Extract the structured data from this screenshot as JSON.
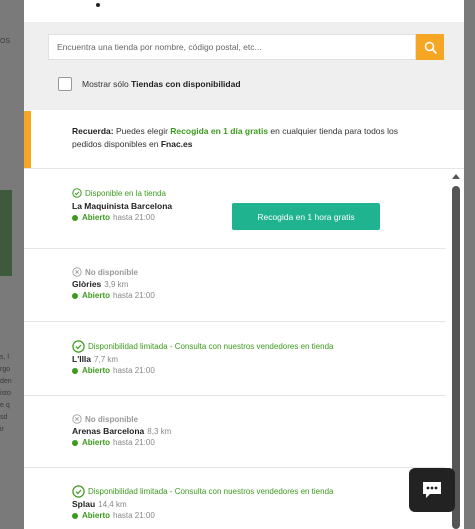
{
  "search": {
    "placeholder": "Encuentra una tienda por nombre, código postal, etc..."
  },
  "filter": {
    "label_prefix": "Mostrar sólo ",
    "label_bold": "Tiendas con disponibilidad"
  },
  "notice": {
    "lead": "Recuerda:",
    "text1": " Puedes elegir ",
    "highlight": "Recogida en 1 día gratis",
    "text2": " en cualquier tienda para todos los pedidos disponibles en ",
    "site": "Fnac.es"
  },
  "stores": [
    {
      "status": "Disponible en la tienda",
      "status_type": "available",
      "name": "La Maquinista Barcelona",
      "distance": "",
      "open_label": "Abierto",
      "hours": "hasta 21:00",
      "button": "Recogida en 1 hora gratis"
    },
    {
      "status": "No disponible",
      "status_type": "none",
      "name": "Glòries",
      "distance": "3,9 km",
      "open_label": "Abierto",
      "hours": "hasta 21:00"
    },
    {
      "status": "Disponibilidad limitada - Consulta con nuestros vendedores en tienda",
      "status_type": "limited",
      "name": "L'Illa",
      "distance": "7,7 km",
      "open_label": "Abierto",
      "hours": "hasta 21:00"
    },
    {
      "status": "No disponible",
      "status_type": "none",
      "name": "Arenas Barcelona",
      "distance": "8,3 km",
      "open_label": "Abierto",
      "hours": "hasta 21:00"
    },
    {
      "status": "Disponibilidad limitada - Consulta con nuestros vendedores en tienda",
      "status_type": "limited",
      "name": "Splau",
      "distance": "14,4 km",
      "open_label": "Abierto",
      "hours": "hasta 21:00"
    }
  ],
  "background": {
    "fragments": [
      "OS",
      "s, l",
      "rgo",
      "den",
      "isto",
      "e q",
      "sd",
      "ir"
    ]
  },
  "colors": {
    "accent_orange": "#f5a623",
    "green": "#3c9b1e",
    "teal_button": "#1fb38f",
    "chat_bg": "#222222"
  }
}
